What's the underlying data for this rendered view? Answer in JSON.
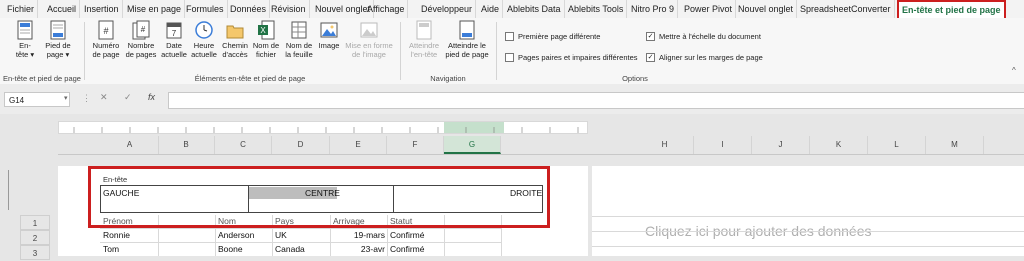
{
  "tabs": [
    "Fichier",
    "Accueil",
    "Insertion",
    "Mise en page",
    "Formules",
    "Données",
    "Révision",
    "Nouvel onglet",
    "Affichage",
    "Développeur",
    "Aide",
    "Ablebits Data",
    "Ablebits Tools",
    "Nitro Pro 9",
    "Power Pivot",
    "Nouvel onglet",
    "SpreadsheetConverter",
    "En-tête et pied de page"
  ],
  "active_tab": "En-tête et pied de page",
  "ribbon": {
    "group1": {
      "buttons": [
        "En-\ntête ▾",
        "Pied de\npage ▾"
      ],
      "label": "En-tête et pied de page"
    },
    "group2": {
      "buttons": [
        "Numéro\nde page",
        "Nombre\nde pages",
        "Date\nactuelle",
        "Heure\nactuelle",
        "Chemin\nd'accès",
        "Nom de\nfichier",
        "Nom de\nla feuille",
        "Image",
        "Mise en forme\nde l'image"
      ],
      "label": "Éléments en-tête et pied de page"
    },
    "group3": {
      "buttons": [
        "Atteindre\nl'en-tête",
        "Atteindre le\npied de page"
      ],
      "label": "Navigation"
    },
    "group4": {
      "options": [
        {
          "label": "Première page différente",
          "checked": false
        },
        {
          "label": "Pages paires et impaires différentes",
          "checked": false
        },
        {
          "label": "Mettre à l'échelle du document",
          "checked": true
        },
        {
          "label": "Aligner sur les marges de page",
          "checked": true
        }
      ],
      "label": "Options"
    }
  },
  "formula_bar": {
    "name_box": "G14",
    "fx": "fx",
    "cancel": "✕",
    "enter": "✓",
    "content": ""
  },
  "columns_left": [
    "A",
    "B",
    "C",
    "D",
    "E",
    "F",
    "G"
  ],
  "columns_right": [
    "H",
    "I",
    "J",
    "K",
    "L",
    "M"
  ],
  "selected_column": "G",
  "header_area": {
    "label": "En-tête",
    "left": "GAUCHE",
    "center": "CENTRE",
    "right": "DROITE"
  },
  "rows": [
    {
      "num": "1",
      "cells": [
        "Prénom",
        "",
        "Nom",
        "Pays",
        "Arrivage",
        "Statut"
      ]
    },
    {
      "num": "2",
      "cells": [
        "Ronnie",
        "",
        "Anderson",
        "UK",
        "19-mars",
        "Confirmé"
      ]
    },
    {
      "num": "3",
      "cells": [
        "Tom",
        "",
        "Boone",
        "Canada",
        "23-avr",
        "Confirmé"
      ]
    }
  ],
  "placeholder": "Cliquez ici pour ajouter des données",
  "colors": {
    "accent": "#217346",
    "highlight": "#cc1f1f"
  }
}
